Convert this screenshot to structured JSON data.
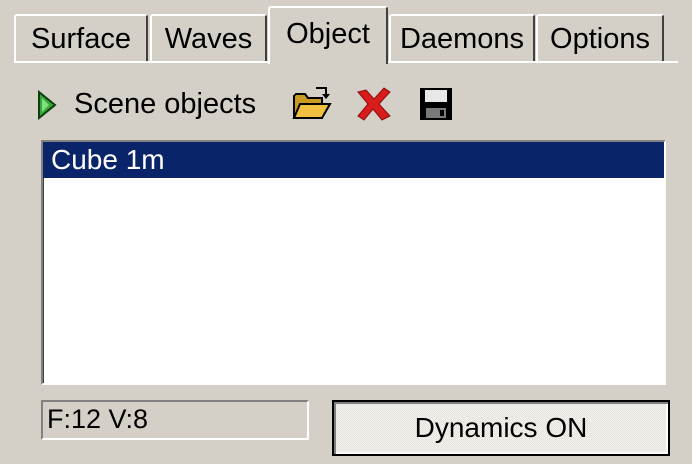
{
  "tabs": [
    {
      "label": "Surface",
      "active": false
    },
    {
      "label": "Waves",
      "active": false
    },
    {
      "label": "Object",
      "active": true
    },
    {
      "label": "Daemons",
      "active": false
    },
    {
      "label": "Options",
      "active": false
    }
  ],
  "toolbar": {
    "label": "Scene objects",
    "icons": [
      "play-icon",
      "open-folder-icon",
      "delete-icon",
      "save-icon"
    ]
  },
  "objects_list": {
    "items": [
      {
        "label": "Cube 1m",
        "selected": true
      }
    ]
  },
  "status": {
    "text": "F:12 V:8"
  },
  "dynamics_button": {
    "label": "Dynamics ON"
  },
  "colors": {
    "panel": "#d4d0c8",
    "selection": "#0a246a",
    "play_icon_green": "#3aa53a",
    "folder_yellow": "#f0c040",
    "delete_red": "#d81c1c"
  }
}
